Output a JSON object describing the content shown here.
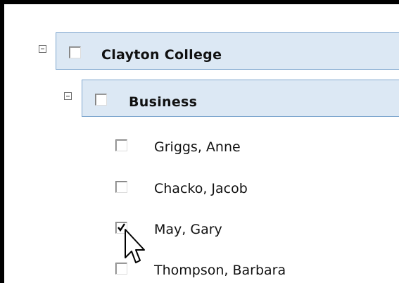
{
  "tree": {
    "root": {
      "label": "Clayton College",
      "expanded": true,
      "checked": false,
      "children": [
        {
          "label": "Business",
          "expanded": true,
          "checked": false,
          "members": [
            {
              "label": "Griggs, Anne",
              "checked": false
            },
            {
              "label": "Chacko, Jacob",
              "checked": false
            },
            {
              "label": "May, Gary",
              "checked": true
            },
            {
              "label": "Thompson, Barbara",
              "checked": false
            }
          ]
        }
      ]
    }
  },
  "colors": {
    "node_background": "#dce8f4",
    "node_border": "#7fa7cf",
    "frame_border": "#000000"
  },
  "icons": {
    "collapse": "minus-square-icon",
    "cursor": "arrow-pointer-icon",
    "checkmark": "checkmark-icon"
  }
}
